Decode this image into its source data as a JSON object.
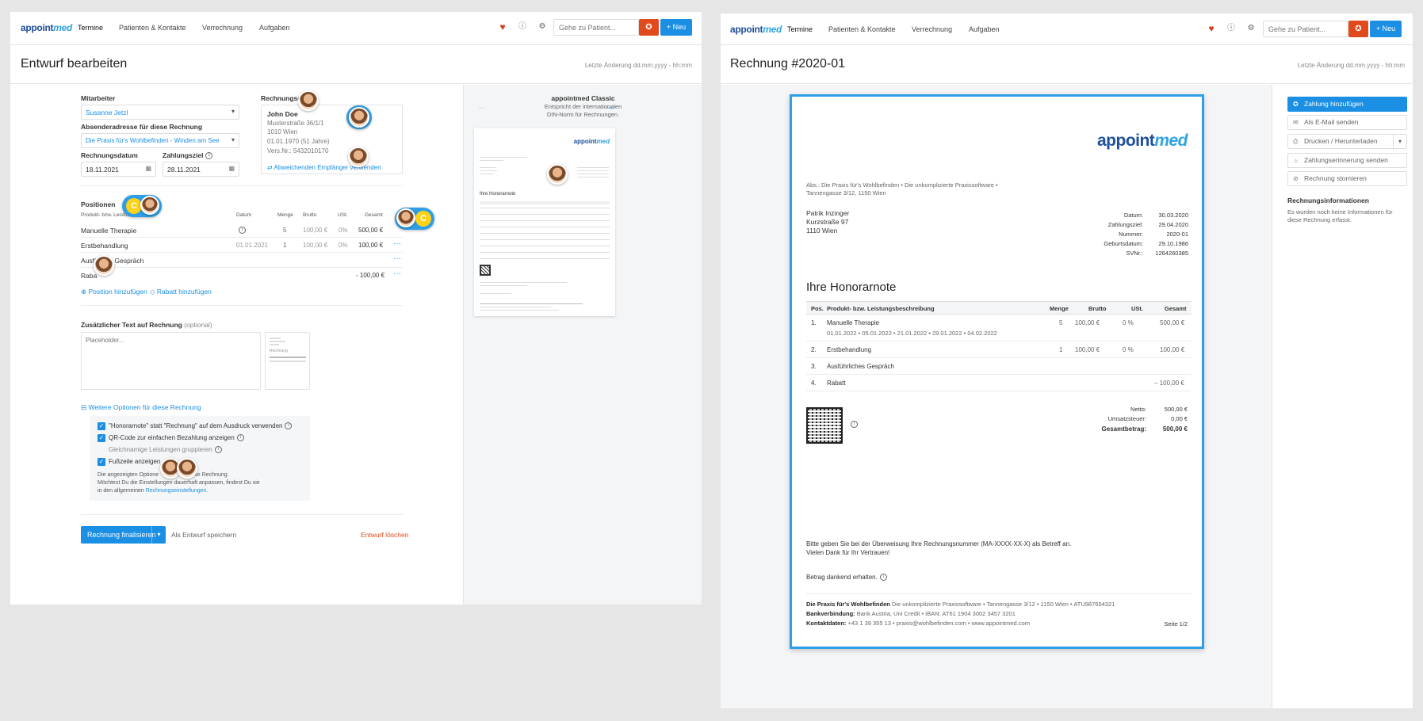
{
  "nav": {
    "logo_a": "appoint",
    "logo_b": "med",
    "termine": "Termine",
    "patienten": "Patienten & Kontakte",
    "verrechnung": "Verrechnung",
    "aufgaben": "Aufgaben",
    "search_placeholder": "Gehe zu Patient...",
    "new_label": "+ Neu"
  },
  "edit": {
    "title": "Entwurf bearbeiten",
    "last_change": "Letzte Änderung dd.mm.yyyy - hh:mm",
    "mitarbeiter_label": "Mitarbeiter",
    "mitarbeiter_value": "Susanne Jetzl",
    "absender_label": "Absenderadresse für diese Rechnung",
    "absender_value": "Die Praxis für's Wohlbefinden - Winden am See",
    "rdatum_label": "Rechnungsdatum",
    "rdatum_value": "18.11.2021",
    "zahlungsziel_label": "Zahlungsziel",
    "zahlungsziel_value": "28.11.2021",
    "empf_label": "Rechnungsem",
    "empf_name": "John Doe",
    "empf_street": "Musterstraße 36/1/1",
    "empf_city": "1010 Wien",
    "empf_birth": "01.01.1970 (51 Jahre)",
    "empf_vers": "Vers.Nr.: 5432010170",
    "empf_link": "Abweichenden Empfänger verwenden",
    "positionen_label": "Positionen",
    "cols": {
      "produkt": "Produkt- bzw. Leistun",
      "datum": "Datum",
      "menge": "Menge",
      "brutto": "Brutto",
      "ust": "USt.",
      "gesamt": "Gesamt"
    },
    "rows": [
      {
        "name": "Manuelle Therapie",
        "datum": "",
        "menge": "5",
        "brutto": "100,00 €",
        "ust": "0%",
        "gesamt": "500,00 €"
      },
      {
        "name": "Erstbehandlung",
        "datum": "01.01.2021",
        "menge": "1",
        "brutto": "100,00 €",
        "ust": "0%",
        "gesamt": "100,00 €"
      },
      {
        "name": "Ausfü      s Gespräch",
        "datum": "",
        "menge": "",
        "brutto": "",
        "ust": "",
        "gesamt": ""
      },
      {
        "name": "Raba",
        "datum": "",
        "menge": "",
        "brutto": "",
        "ust": "",
        "gesamt": "- 100,00 €"
      }
    ],
    "add_position": "Position hinzufügen",
    "add_rabatt": "Rabatt hinzufügen",
    "zusatz_label": "Zusätzlicher Text auf Rechnung",
    "zusatz_opt": "(optional)",
    "zusatz_placeholder": "Placeholder...",
    "thumb_label": "Rechnung",
    "weitere": "Weitere Optionen für diese Rechnung",
    "opt1": "\"Honorarnote\" statt \"Rechnung\" auf dem Ausdruck verwenden",
    "opt2": "QR-Code zur einfachen Bezahlung anzeigen",
    "opt3": "Gleichnamige Leistungen gruppieren",
    "opt4": "Fußzeile anzeigen",
    "note1": "Die angezeigten Optione",
    "note1b": "diese Rechnung.",
    "note2": "Möchtest Du die Einstellungen dauerhaft anpassen, findest Du sie",
    "note3": "in den allgemeinen ",
    "note3_link": "Rechnungseinstellungen.",
    "finalize": "Rechnung finalisieren",
    "save_draft": "Als Entwurf speichern",
    "delete_draft": "Entwurf löschen",
    "preview_title": "appointmed Classic",
    "preview_sub1": "Entspricht der internationalen",
    "preview_sub2": "DIN-Norm für Rechnungen.",
    "avatar_coin": "C"
  },
  "invoice": {
    "title": "Rechnung #2020-01",
    "last_change": "Letzte Änderung dd.mm.yyyy - hh:mm",
    "abs": "Abs.: Die Praxis für's Wohlbefinden • Die unkomplizierte Praxissoftware •",
    "abs2": "Tannengasse 3/12, 1150 Wien",
    "recipient": [
      "Patrik Inzinger",
      "Kurzstraße 97",
      "1110 Wien"
    ],
    "meta": [
      {
        "k": "Datum:",
        "v": "30.03.2020"
      },
      {
        "k": "Zahlungsziel:",
        "v": "29.04.2020"
      },
      {
        "k": "Nummer:",
        "v": "2020-01"
      },
      {
        "k": "Geburtsdatum:",
        "v": "29.10.1986"
      },
      {
        "k": "SVNr.:",
        "v": "1264260385"
      }
    ],
    "heading": "Ihre Honorarnote",
    "cols": {
      "pos": "Pos.",
      "desc": "Produkt- bzw. Leistungsbeschreibung",
      "menge": "Menge",
      "brutto": "Brutto",
      "ust": "USt.",
      "gesamt": "Gesamt"
    },
    "rows": [
      {
        "pos": "1.",
        "desc": "Manuelle Therapie",
        "sub": "01.01.2022 • 05.01.2022 • 21.01.2022 • 29.01.2022 • 04.02.2022",
        "menge": "5",
        "brutto": "100,00 €",
        "ust": "0 %",
        "gesamt": "500,00 €"
      },
      {
        "pos": "2.",
        "desc": "Erstbehandlung",
        "sub": "",
        "menge": "1",
        "brutto": "100,00 €",
        "ust": "0 %",
        "gesamt": "100,00 €"
      },
      {
        "pos": "3.",
        "desc": "Ausführliches Gespräch",
        "sub": "",
        "menge": "",
        "brutto": "",
        "ust": "",
        "gesamt": ""
      },
      {
        "pos": "4.",
        "desc": "Rabatt",
        "sub": "",
        "menge": "",
        "brutto": "",
        "ust": "",
        "gesamt": "– 100,00 €"
      }
    ],
    "netto_k": "Netto:",
    "netto_v": "500,00 €",
    "ust_k": "Umsatzsteuer:",
    "ust_v": "0,00 €",
    "gesamt_k": "Gesamtbetrag:",
    "gesamt_v": "500,00 €",
    "qr_side": "QR-Code",
    "pay1": "Bitte geben Sie bei der Überweisung Ihre Rechnungsnummer (MA-XXXX-XX-X) als Betreff an.",
    "pay2": "Vielen Dank für Ihr Vertrauen!",
    "received": "Betrag dankend erhalten.",
    "f1_b": "Die Praxis für's Wohlbefinden",
    "f1": " Die unkomplizierte Praxissoftware • Tannengasse 3/12 • 1150 Wien • ATU987654321",
    "f2_b": "Bankverbindung:",
    "f2": " Bank Austria, Uni Credit • IBAN: AT61 1904 3002 3457 3201",
    "f3_b": "Kontaktdaten:",
    "f3": " +43 1 39 355 13 • praxis@wohlbefinden.com • www.appointmed.com",
    "page": "Seite 1/2",
    "actions": [
      "Zahlung hinzufügen",
      "Als E-Mail senden",
      "Drucken / Herunterladen",
      "Zahlungserinnerung senden",
      "Rechnung stornieren"
    ],
    "info_title": "Rechnungsinformationen",
    "info_text1": "Es wurden noch keine Informationen für",
    "info_text2": "diese Rechnung erfasst."
  },
  "colors": {
    "accent": "#1a8fe3",
    "danger": "#e04a1c",
    "heart": "#d9391b"
  }
}
